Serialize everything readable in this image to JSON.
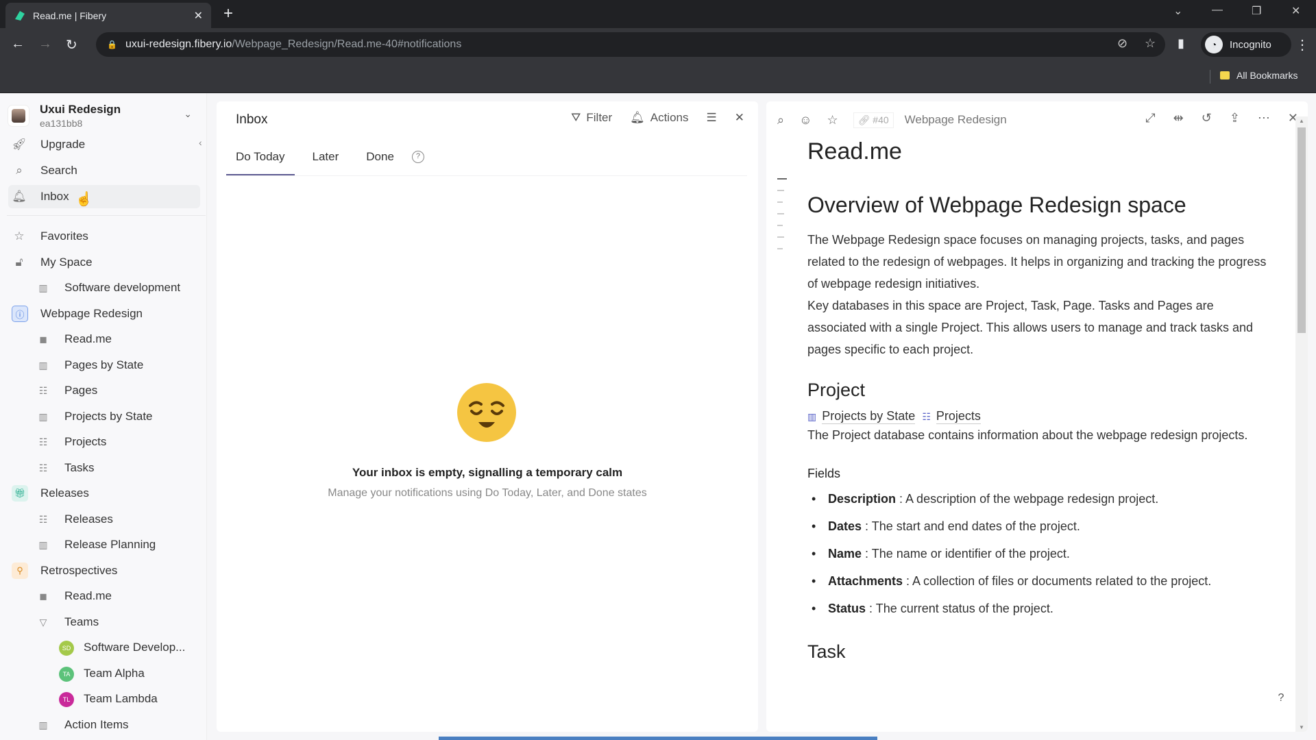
{
  "browser": {
    "tab_title": "Read.me | Fibery",
    "url_host": "uxui-redesign.fibery.io",
    "url_path": "/Webpage_Redesign/Read.me-40#notifications",
    "profile_label": "Incognito",
    "bookmarks_label": "All Bookmarks"
  },
  "sidebar": {
    "workspace_name": "Uxui Redesign",
    "workspace_id": "ea131bb8",
    "top_items": [
      {
        "label": "Upgrade",
        "icon": "rocket-icon"
      },
      {
        "label": "Search",
        "icon": "search-icon"
      },
      {
        "label": "Inbox",
        "icon": "bell-icon"
      }
    ],
    "items": [
      {
        "label": "Favorites",
        "icon": "star-icon"
      },
      {
        "label": "My Space",
        "icon": "lock-icon"
      },
      {
        "label": "Software development",
        "icon": "board-icon"
      },
      {
        "label": "Webpage Redesign",
        "icon": "space-icon"
      },
      {
        "label": "Read.me",
        "icon": "document-icon"
      },
      {
        "label": "Pages by State",
        "icon": "board-icon"
      },
      {
        "label": "Pages",
        "icon": "table-icon"
      },
      {
        "label": "Projects by State",
        "icon": "board-icon"
      },
      {
        "label": "Projects",
        "icon": "table-icon"
      },
      {
        "label": "Tasks",
        "icon": "table-icon"
      },
      {
        "label": "Releases",
        "icon": "gift-icon"
      },
      {
        "label": "Releases",
        "icon": "table-icon"
      },
      {
        "label": "Release Planning",
        "icon": "board-icon"
      },
      {
        "label": "Retrospectives",
        "icon": "retro-icon"
      },
      {
        "label": "Read.me",
        "icon": "document-icon"
      },
      {
        "label": "Teams",
        "icon": "triangle-down-icon"
      },
      {
        "label": "Software Develop...",
        "avatar": "SD",
        "color": "#a4c94a"
      },
      {
        "label": "Team Alpha",
        "avatar": "TA",
        "color": "#5cc27a"
      },
      {
        "label": "Team Lambda",
        "avatar": "TL",
        "color": "#c92a9a"
      },
      {
        "label": "Action Items",
        "icon": "board-icon"
      }
    ]
  },
  "inbox": {
    "title": "Inbox",
    "filter_label": "Filter",
    "actions_label": "Actions",
    "tabs": [
      "Do Today",
      "Later",
      "Done"
    ],
    "active_tab": "Do Today",
    "help": "?",
    "empty_title": "Your inbox is empty, signalling a temporary calm",
    "empty_subtitle": "Manage your notifications using Do Today, Later, and Done states"
  },
  "document": {
    "id_ref": "#40",
    "breadcrumb": "Webpage Redesign",
    "title": "Read.me",
    "heading": "Overview of Webpage Redesign space",
    "para1": "The Webpage Redesign space focuses on managing projects, tasks, and pages related to the redesign of webpages. It helps in organizing and tracking the progress of webpage redesign initiatives.",
    "para2": "Key databases in this space are Project, Task, Page. Tasks and Pages are associated with a single Project. This allows users to manage and track tasks and pages specific to each project.",
    "section_project": "Project",
    "links": [
      "Projects by State",
      "Projects"
    ],
    "project_desc": "The Project database contains information about the webpage redesign projects.",
    "fields_label": "Fields",
    "fields": [
      {
        "name": "Description",
        "desc": " : A description of the webpage redesign project."
      },
      {
        "name": "Dates",
        "desc": " : The start and end dates of the project."
      },
      {
        "name": "Name",
        "desc": " : The name or identifier of the project."
      },
      {
        "name": "Attachments",
        "desc": " : A collection of files or documents related to the project."
      },
      {
        "name": "Status",
        "desc": " : The current status of the project."
      }
    ],
    "section_task": "Task",
    "help": "?"
  },
  "colors": {
    "accent": "#5c5a91",
    "link_icon": "#5a64c8",
    "progress": "#4a7fc1"
  }
}
